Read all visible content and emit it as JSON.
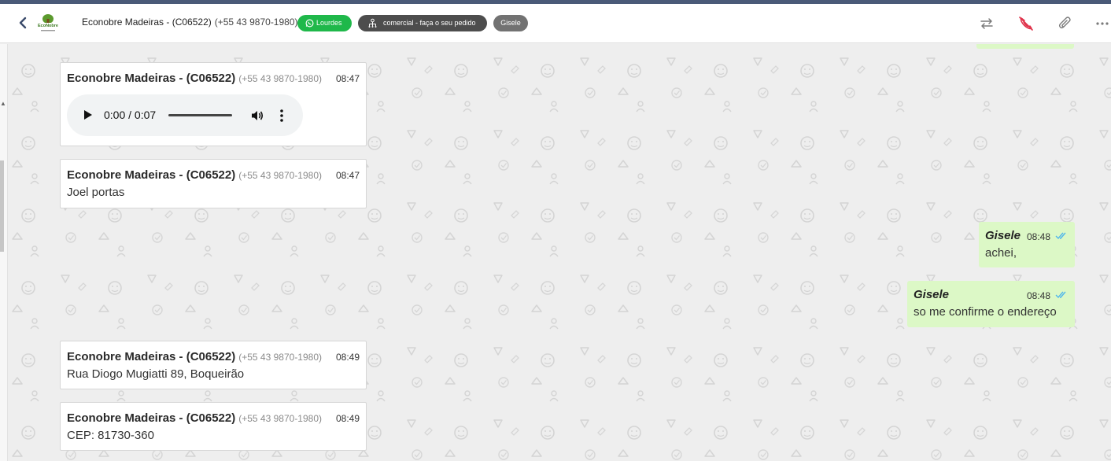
{
  "header": {
    "contact_name": "Econobre Madeiras - (C06522)",
    "contact_phone": "(+55 43 9870-1980)",
    "tags": {
      "whatsapp_label": "Lourdes",
      "department_label": "comercial - faça o seu pedido",
      "user_label": "Gisele"
    },
    "logo_text": "EcoNobre"
  },
  "colors": {
    "incoming_bubble": "#ffffff",
    "outgoing_bubble": "#dcf8c6",
    "whatsapp_tag": "#1fb84a",
    "read_check": "#4fb6ec",
    "end_call": "#e0324a"
  },
  "icons": [
    "back-icon",
    "transfer-icon",
    "end-call-icon",
    "attach-icon",
    "more-icon",
    "whatsapp-icon",
    "department-icon",
    "play-icon",
    "volume-icon",
    "audio-menu-icon",
    "double-check-icon"
  ],
  "messages": {
    "m1": {
      "sender": "Econobre Madeiras - (C06522)",
      "phone": "(+55 43 9870-1980)",
      "time": "08:47",
      "audio_time": "0:00 / 0:07"
    },
    "m2": {
      "sender": "Econobre Madeiras - (C06522)",
      "phone": "(+55 43 9870-1980)",
      "time": "08:47",
      "text": "Joel portas"
    },
    "m3": {
      "sender": "Gisele",
      "time": "08:48",
      "text": "achei,"
    },
    "m4": {
      "sender": "Gisele",
      "time": "08:48",
      "text": "so me confirme o endereço"
    },
    "m5": {
      "sender": "Econobre Madeiras - (C06522)",
      "phone": "(+55 43 9870-1980)",
      "time": "08:49",
      "text": "Rua Diogo Mugiatti 89, Boqueirão"
    },
    "m6": {
      "sender": "Econobre Madeiras - (C06522)",
      "phone": "(+55 43 9870-1980)",
      "time": "08:49",
      "text": "CEP: 81730-360"
    }
  }
}
